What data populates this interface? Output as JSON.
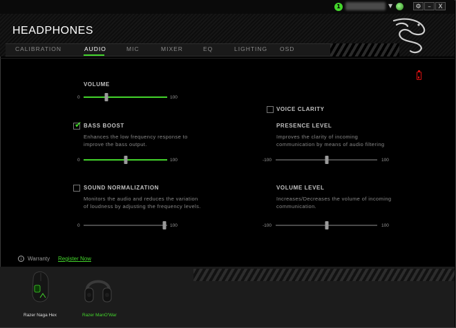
{
  "titlebar": {
    "notification_count": "1",
    "caret_glyph": "▼",
    "settings_glyph": "⚙",
    "minimize_glyph": "–",
    "close_glyph": "X"
  },
  "header": {
    "title": "HEADPHONES"
  },
  "tabs": [
    {
      "label": "CALIBRATION",
      "active": false
    },
    {
      "label": "AUDIO",
      "active": true
    },
    {
      "label": "MIC",
      "active": false
    },
    {
      "label": "MIXER",
      "active": false
    },
    {
      "label": "EQ",
      "active": false
    },
    {
      "label": "LIGHTING",
      "active": false
    },
    {
      "label": "OSD",
      "active": false
    }
  ],
  "colors": {
    "accent": "#44d62c",
    "battery": "#e01010",
    "background": "#000000"
  },
  "battery": {
    "status": "low",
    "icon": "battery-low-icon"
  },
  "audio": {
    "volume": {
      "label": "VOLUME",
      "min": "0",
      "max": "100",
      "value_fraction": 0.27
    },
    "bass_boost": {
      "label": "BASS BOOST",
      "checked": true,
      "desc_line1": "Enhances the low frequency response to",
      "desc_line2": "improve the bass output.",
      "min": "0",
      "max": "100",
      "value_fraction": 0.5
    },
    "sound_normalization": {
      "label": "SOUND NORMALIZATION",
      "checked": false,
      "desc_line1": "Monitors the audio and reduces the variation",
      "desc_line2": "of loudness by adjusting the frequency levels.",
      "min": "0",
      "max": "100",
      "value_fraction": 0.97
    }
  },
  "voice": {
    "voice_clarity": {
      "label": "VOICE CLARITY",
      "checked": false
    },
    "presence_level": {
      "label": "PRESENCE LEVEL",
      "desc_line1": "Improves the clarity of incoming",
      "desc_line2": "communication by means of audio filtering",
      "min": "-100",
      "max": "100",
      "value_fraction": 0.5
    },
    "volume_level": {
      "label": "VOLUME LEVEL",
      "desc_line1": "Increases/Decreases the volume of incoming",
      "desc_line2": "communication.",
      "min": "-100",
      "max": "100",
      "value_fraction": 0.5
    }
  },
  "footer": {
    "warranty_icon_glyph": "i",
    "warranty_label": "Warranty",
    "register_label": "Register Now"
  },
  "devices": [
    {
      "name": "Razer Naga Hex",
      "icon": "mouse-icon",
      "active": false
    },
    {
      "name": "Razer ManO'War",
      "icon": "headset-icon",
      "active": true
    }
  ]
}
